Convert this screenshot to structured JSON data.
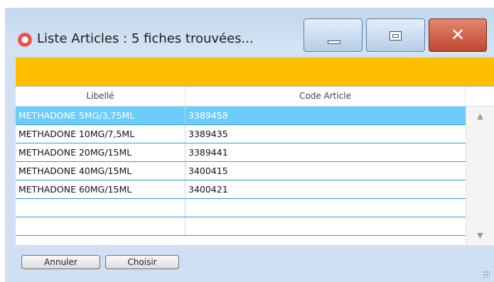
{
  "window": {
    "title": "Liste Articles : 5 fiches trouvées...",
    "icon": "lifebuoy-icon",
    "minimize_icon": "minimize-icon",
    "maximize_icon": "maximize-icon",
    "close_glyph": "✕",
    "banner_color": "#FFBF00",
    "selection_color": "#6CCDFC"
  },
  "table": {
    "columns": [
      "Libellé",
      "Code Article"
    ],
    "rows": [
      {
        "libelle": "METHADONE 5MG/3,75ML",
        "code": "3389458",
        "selected": true
      },
      {
        "libelle": "METHADONE 10MG/7,5ML",
        "code": "3389435",
        "selected": false
      },
      {
        "libelle": "METHADONE 20MG/15ML",
        "code": "3389441",
        "selected": false
      },
      {
        "libelle": "METHADONE 40MG/15ML",
        "code": "3400415",
        "selected": false
      },
      {
        "libelle": "METHADONE 60MG/15ML",
        "code": "3400421",
        "selected": false
      },
      {
        "libelle": "",
        "code": "",
        "selected": false
      },
      {
        "libelle": "",
        "code": "",
        "selected": false
      }
    ],
    "scroll_up_glyph": "▲",
    "scroll_down_glyph": "▼"
  },
  "buttons": {
    "cancel": "Annuler",
    "choose": "Choisir"
  }
}
